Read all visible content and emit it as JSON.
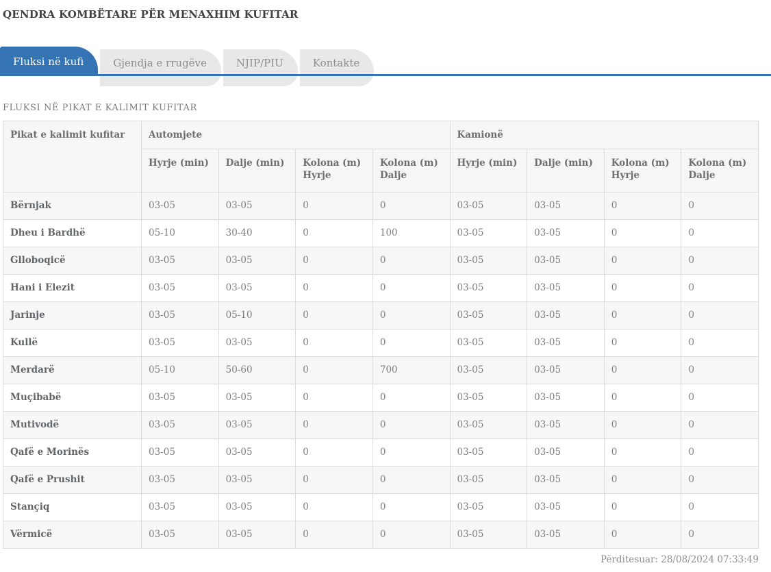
{
  "page": {
    "title": "QENDRA KOMBËTARE PËR MENAXHIM KUFITAR",
    "updated": "Përditesuar: 28/08/2024 07:33:49"
  },
  "tabs": [
    {
      "label": "Fluksi në kufi",
      "active": true
    },
    {
      "label": "Gjendja e rrugëve",
      "active": false
    },
    {
      "label": "NJIP/PIU",
      "active": false
    },
    {
      "label": "Kontakte",
      "active": false
    }
  ],
  "section": {
    "heading": "FLUKSI NË PIKAT E KALIMIT KUFITAR"
  },
  "table": {
    "col_header": "Pikat e kalimit kufitar",
    "groups": [
      {
        "label": "Automjete"
      },
      {
        "label": "Kamionë"
      }
    ],
    "sub_headers": [
      "Hyrje (min)",
      "Dalje (min)",
      "Kolona (m) Hyrje",
      "Kolona (m) Dalje",
      "Hyrje (min)",
      "Dalje (min)",
      "Kolona (m) Hyrje",
      "Kolona (m) Dalje"
    ],
    "rows": [
      {
        "name": "Bërnjak",
        "values": [
          "03-05",
          "03-05",
          "0",
          "0",
          "03-05",
          "03-05",
          "0",
          "0"
        ]
      },
      {
        "name": "Dheu i Bardhë",
        "values": [
          "05-10",
          "30-40",
          "0",
          "100",
          "03-05",
          "03-05",
          "0",
          "0"
        ]
      },
      {
        "name": "Glloboqicë",
        "values": [
          "03-05",
          "03-05",
          "0",
          "0",
          "03-05",
          "03-05",
          "0",
          "0"
        ]
      },
      {
        "name": "Hani i Elezit",
        "values": [
          "03-05",
          "03-05",
          "0",
          "0",
          "03-05",
          "03-05",
          "0",
          "0"
        ]
      },
      {
        "name": "Jarinje",
        "values": [
          "03-05",
          "05-10",
          "0",
          "0",
          "03-05",
          "03-05",
          "0",
          "0"
        ]
      },
      {
        "name": "Kullë",
        "values": [
          "03-05",
          "03-05",
          "0",
          "0",
          "03-05",
          "03-05",
          "0",
          "0"
        ]
      },
      {
        "name": "Merdarë",
        "values": [
          "05-10",
          "50-60",
          "0",
          "700",
          "03-05",
          "03-05",
          "0",
          "0"
        ]
      },
      {
        "name": "Muçibabë",
        "values": [
          "03-05",
          "03-05",
          "0",
          "0",
          "03-05",
          "03-05",
          "0",
          "0"
        ]
      },
      {
        "name": "Mutivodë",
        "values": [
          "03-05",
          "03-05",
          "0",
          "0",
          "03-05",
          "03-05",
          "0",
          "0"
        ]
      },
      {
        "name": "Qafë e Morinës",
        "values": [
          "03-05",
          "03-05",
          "0",
          "0",
          "03-05",
          "03-05",
          "0",
          "0"
        ]
      },
      {
        "name": "Qafë e Prushit",
        "values": [
          "03-05",
          "03-05",
          "0",
          "0",
          "03-05",
          "03-05",
          "0",
          "0"
        ]
      },
      {
        "name": "Stançiq",
        "values": [
          "03-05",
          "03-05",
          "0",
          "0",
          "03-05",
          "03-05",
          "0",
          "0"
        ]
      },
      {
        "name": "Vërmicë",
        "values": [
          "03-05",
          "03-05",
          "0",
          "0",
          "03-05",
          "03-05",
          "0",
          "0"
        ]
      }
    ]
  },
  "colors": {
    "accent_blue": "#3474b4",
    "active_tab_text": "#ffffff",
    "inactive_tab_bg": "#e8e8e8",
    "inactive_tab_text": "#8d8d8d",
    "header_row_bg": "#f6f6f6",
    "stripe_row_bg": "#f7f7f7",
    "table_border": "#dcdcdc"
  }
}
